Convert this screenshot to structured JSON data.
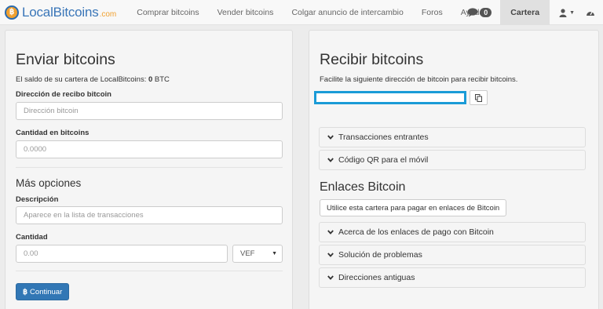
{
  "brand": {
    "name": "LocalBitcoins",
    "suffix": ".com"
  },
  "nav": {
    "links": [
      "Comprar bitcoins",
      "Vender bitcoins",
      "Colgar anuncio de intercambio",
      "Foros",
      "Ayuda"
    ],
    "messages_count": "0",
    "wallet_tab": "Cartera"
  },
  "send": {
    "title": "Enviar bitcoins",
    "balance_prefix": "El saldo de su cartera de LocalBitcoins:",
    "balance_value": "0",
    "balance_unit": "BTC",
    "address_label": "Dirección de recibo bitcoin",
    "address_placeholder": "Dirección bitcoin",
    "amount_label": "Cantidad en bitcoins",
    "amount_placeholder": "0.0000",
    "more_options": "Más opciones",
    "description_label": "Descripción",
    "description_placeholder": "Aparece en la lista de transacciones",
    "quantity_label": "Cantidad",
    "quantity_placeholder": "0.00",
    "currency": "VEF",
    "continue_label": "Continuar"
  },
  "receive": {
    "title": "Recibir bitcoins",
    "subtitle": "Facilite la siguiente dirección de bitcoin para recibir bitcoins.",
    "incoming": "Transacciones entrantes",
    "qr": "Código QR para el móvil",
    "links_title": "Enlaces Bitcoin",
    "use_wallet_button": "Utilice esta cartera para pagar en enlaces de Bitcoin",
    "about_links": "Acerca de los enlaces de pago con Bitcoin",
    "troubleshooting": "Solución de problemas",
    "old_addresses": "Direcciones antiguas"
  }
}
